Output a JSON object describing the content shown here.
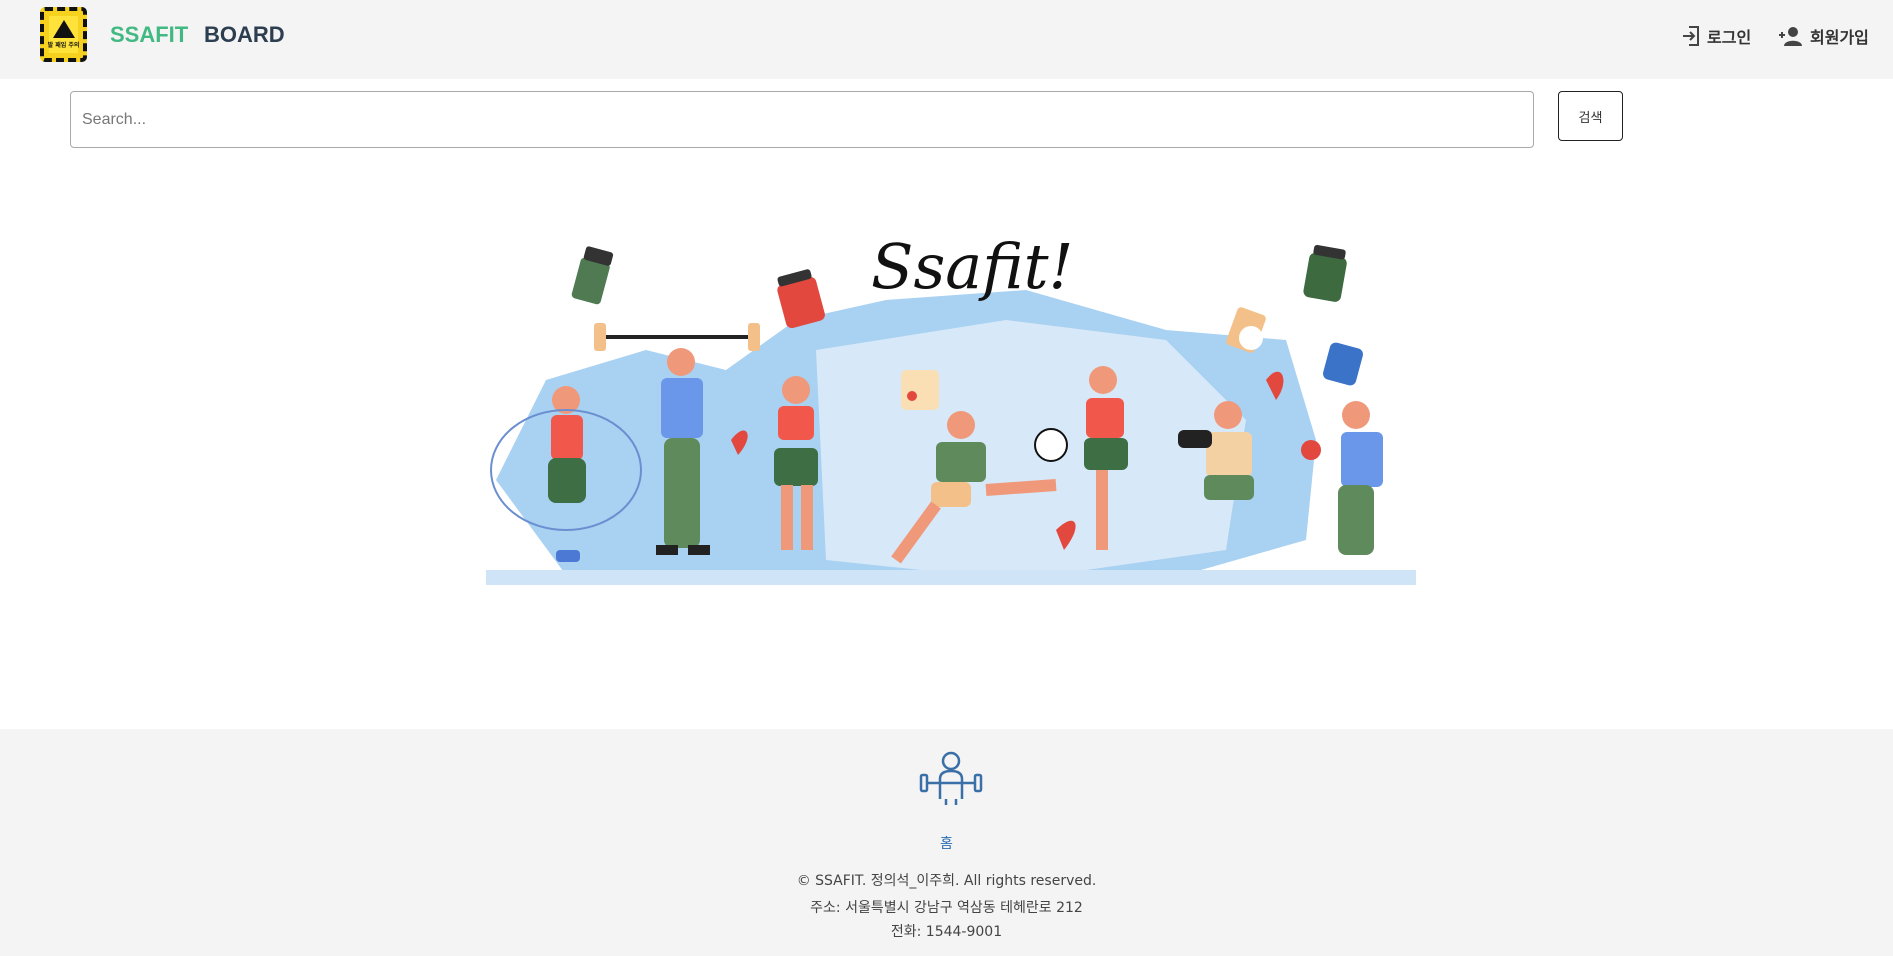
{
  "header": {
    "logo_caption": "발 패임 주의",
    "nav": {
      "brand": "SSAFIT",
      "board": "BOARD"
    },
    "auth": {
      "login": "로그인",
      "signup": "회원가입"
    }
  },
  "search": {
    "placeholder": "Search...",
    "value": "",
    "button_label": "검색"
  },
  "hero": {
    "title": "Ssafit!"
  },
  "footer": {
    "home_link": "홈",
    "copyright": "© SSAFIT. 정의석_이주희. All rights reserved.",
    "address": "주소: 서울특별시 강남구 역삼동 테헤란로 212",
    "phone": "전화: 1544-9001"
  },
  "colors": {
    "brand": "#42b983",
    "text": "#2c3e50",
    "header_bg": "#f4f4f4",
    "link": "#2a6fb0"
  }
}
